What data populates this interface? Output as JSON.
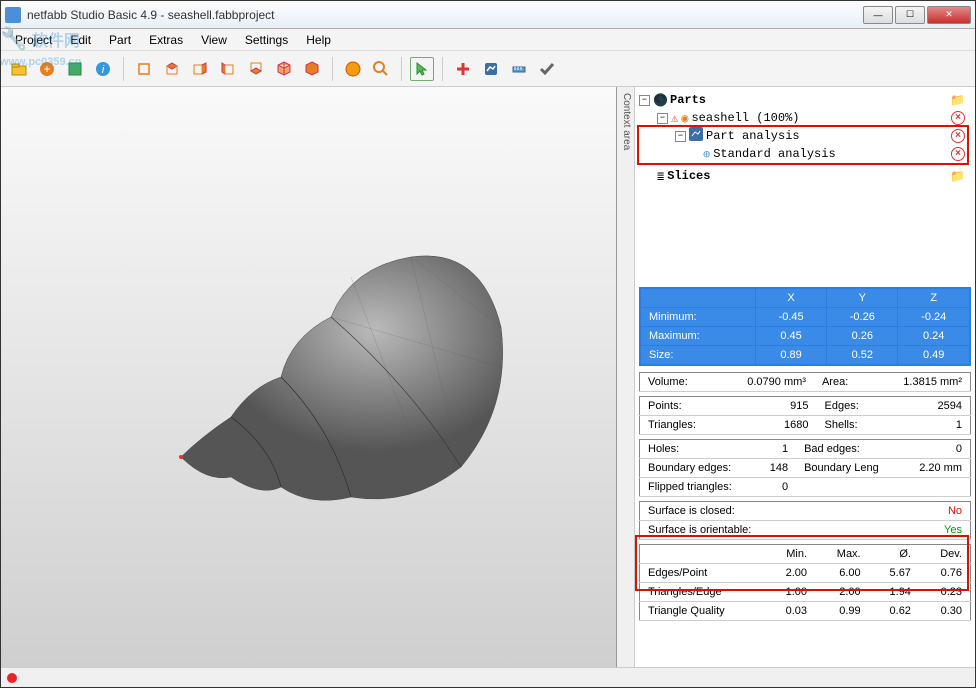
{
  "title": "netfabb Studio Basic 4.9 - seashell.fabbproject",
  "watermark": "软件网",
  "watermark2": "www.pc0359.cn",
  "menu": [
    "Project",
    "Edit",
    "Part",
    "Extras",
    "View",
    "Settings",
    "Help"
  ],
  "context_tab": "Context area",
  "tree": {
    "parts_label": "Parts",
    "part_name": "seashell (100%)",
    "analysis": "Part analysis",
    "std_analysis": "Standard analysis",
    "slices_label": "Slices"
  },
  "dims": {
    "headers": [
      "",
      "X",
      "Y",
      "Z"
    ],
    "rows": [
      {
        "label": "Minimum:",
        "x": "-0.45",
        "y": "-0.26",
        "z": "-0.24"
      },
      {
        "label": "Maximum:",
        "x": "0.45",
        "y": "0.26",
        "z": "0.24"
      },
      {
        "label": "Size:",
        "x": "0.89",
        "y": "0.52",
        "z": "0.49"
      }
    ]
  },
  "vol": {
    "volume_k": "Volume:",
    "volume_v": "0.0790 mm³",
    "area_k": "Area:",
    "area_v": "1.3815 mm²"
  },
  "mesh": {
    "points_k": "Points:",
    "points_v": "915",
    "edges_k": "Edges:",
    "edges_v": "2594",
    "tri_k": "Triangles:",
    "tri_v": "1680",
    "shells_k": "Shells:",
    "shells_v": "1"
  },
  "err": {
    "holes_k": "Holes:",
    "holes_v": "1",
    "bad_k": "Bad edges:",
    "bad_v": "0",
    "bound_k": "Boundary edges:",
    "bound_v": "148",
    "blen_k": "Boundary Leng",
    "blen_v": "2.20 mm",
    "flip_k": "Flipped triangles:",
    "flip_v": "0"
  },
  "surf": {
    "closed_k": "Surface is closed:",
    "closed_v": "No",
    "orient_k": "Surface is orientable:",
    "orient_v": "Yes"
  },
  "stats": {
    "headers": [
      "",
      "Min.",
      "Max.",
      "Ø.",
      "Dev."
    ],
    "rows": [
      {
        "k": "Edges/Point",
        "min": "2.00",
        "max": "6.00",
        "avg": "5.67",
        "dev": "0.76"
      },
      {
        "k": "Triangles/Edge",
        "min": "1.00",
        "max": "2.00",
        "avg": "1.94",
        "dev": "0.23"
      },
      {
        "k": "Triangle Quality",
        "min": "0.03",
        "max": "0.99",
        "avg": "0.62",
        "dev": "0.30"
      }
    ]
  }
}
